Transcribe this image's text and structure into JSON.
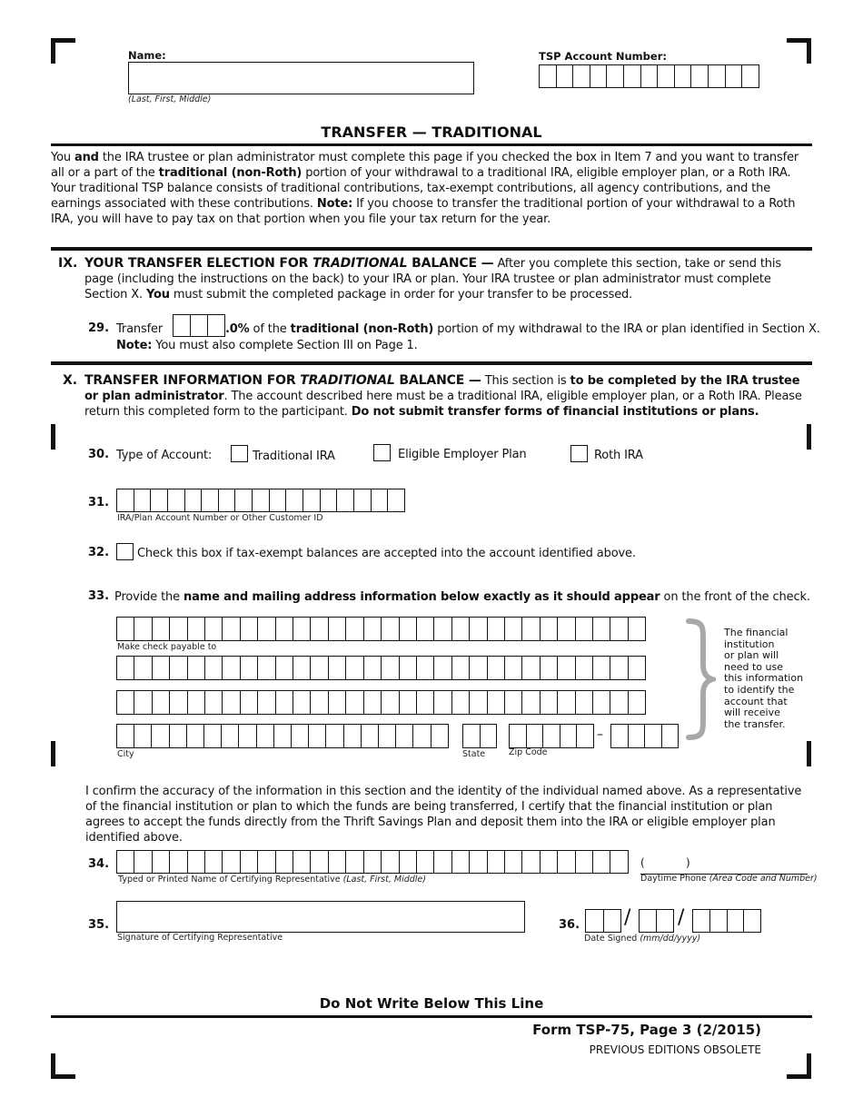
{
  "header": {
    "name_label": "Name:",
    "name_caption": "(Last, First, Middle)",
    "tsp_label": "TSP Account Number:",
    "tsp_box_count": 13
  },
  "title": "TRANSFER — TRADITIONAL",
  "intro": {
    "p1": "You ",
    "b1": "and",
    "p2": " the IRA trustee or plan administrator must complete this page if you checked the box in Item 7 and you want to transfer all or a part of the ",
    "b2": "traditional (non-Roth)",
    "p3": " portion of your withdrawal to a traditional IRA, eligible employer plan, or a Roth IRA. Your traditional TSP balance consists of traditional contributions, tax-exempt contributions, all agency contributions, and the earnings associated with these contributions. ",
    "b3": "Note:",
    "p4": " If you choose to transfer the traditional portion of your withdrawal to a Roth IRA, you will have to pay tax on that portion when you file your tax return for the year."
  },
  "section9": {
    "roman": "IX.",
    "title_a": "YOUR TRANSFER ELECTION FOR ",
    "title_i": "TRADITIONAL",
    "title_b": " BALANCE —",
    "text1": " After you complete this section, take or send this page (including the instructions on the back) to your IRA or plan. Your IRA trustee or plan administrator must complete Section X. ",
    "bold_you": "You",
    "text2": " must submit the completed package in order for your transfer to be processed.",
    "item29": {
      "num": "29.",
      "pre": "Transfer",
      "suffix_bold": ".0%",
      "mid": " of the ",
      "bold2": "traditional (non-Roth)",
      "post": " portion of my withdrawal to the IRA or plan identified in Section X.",
      "note_bold": "Note:",
      "note": " You must also complete Section III on Page 1."
    }
  },
  "section10": {
    "roman": "X.",
    "title_a": "TRANSFER INFORMATION FOR ",
    "title_i": "TRADITIONAL",
    "title_b": " BALANCE —",
    "text1": " This section is ",
    "bold1": "to be completed by the IRA trustee or plan administrator",
    "text2": ". The account described here must be a traditional IRA, eligible employer plan, or a Roth IRA. Please return this completed form to the participant. ",
    "bold2": "Do not submit transfer forms of financial institutions or plans.",
    "item30": {
      "num": "30.",
      "label": "Type of Account:",
      "options": [
        "Traditional IRA",
        "Eligible Employer Plan",
        "Roth IRA"
      ]
    },
    "item31": {
      "num": "31.",
      "caption": "IRA/Plan Account Number or Other Customer ID"
    },
    "item32": {
      "num": "32.",
      "label": "Check this box if tax-exempt balances are accepted into the account identified above."
    },
    "item33": {
      "num": "33.",
      "pre": "Provide the ",
      "bold": "name and mailing address information below exactly as it should appear",
      "post": " on the front of the check.",
      "payable_caption": "Make check payable to",
      "city_caption": "City",
      "state_caption": "State",
      "zip_caption": "Zip Code",
      "zip_dash": "–",
      "side_note": [
        "The financial",
        "institution",
        "or plan will",
        "need to use",
        "this information",
        "to identify the",
        "account that",
        "will receive",
        "the transfer."
      ]
    },
    "certification": "I confirm the accuracy of the information in this section and the identity of the individual named above. As a representative of the financial institution or plan to which the funds are being transferred, I certify that the financial institution or plan agrees to accept the funds directly from the Thrift Savings Plan and deposit them into the IRA or eligible employer plan identified above.",
    "item34": {
      "num": "34.",
      "caption": "Typed or Printed Name of Certifying Representative ",
      "caption_i": "(Last, First, Middle)",
      "phone_open": "(",
      "phone_close": ")",
      "phone_caption": "Daytime Phone ",
      "phone_caption_i": "(Area Code and Number)"
    },
    "item35": {
      "num": "35.",
      "caption": "Signature of Certifying Representative"
    },
    "item36": {
      "num": "36.",
      "sep": "/",
      "caption": "Date Signed ",
      "caption_i": "(mm/dd/yyyy)"
    }
  },
  "footer": {
    "do_not_write": "Do Not Write Below This Line",
    "form_id": "Form TSP-75, Page 3 (2/2015)",
    "obsolete": "PREVIOUS EDITIONS OBSOLETE"
  }
}
